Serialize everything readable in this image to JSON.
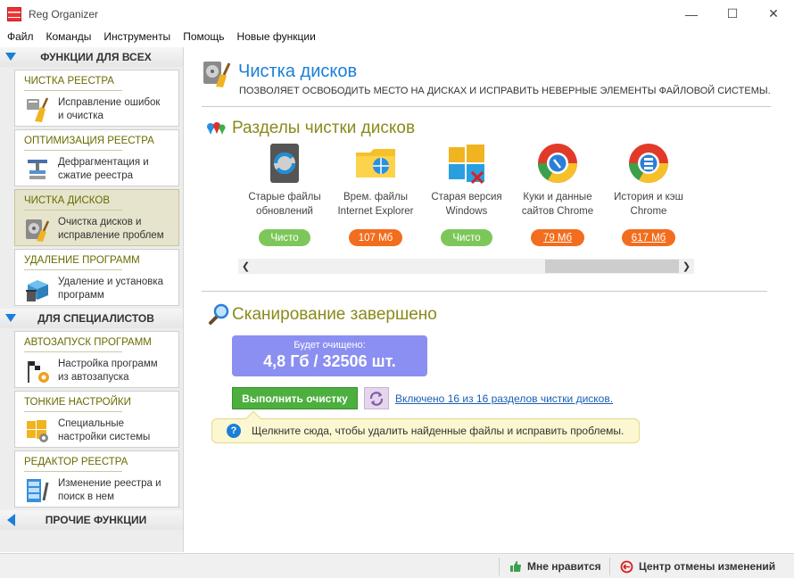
{
  "window": {
    "title": "Reg Organizer"
  },
  "menu": [
    "Файл",
    "Команды",
    "Инструменты",
    "Помощь",
    "Новые функции"
  ],
  "sidebar": {
    "section_all": "ФУНКЦИИ ДЛЯ ВСЕХ",
    "section_pro": "ДЛЯ СПЕЦИАЛИСТОВ",
    "section_other": "ПРОЧИЕ ФУНКЦИИ",
    "items": [
      {
        "title": "ЧИСТКА РЕЕСТРА",
        "desc1": "Исправление ошибок",
        "desc2": "и очистка",
        "icon": "broom-icon"
      },
      {
        "title": "ОПТИМИЗАЦИЯ РЕЕСТРА",
        "desc1": "Дефрагментация и",
        "desc2": "сжатие реестра",
        "icon": "press-icon"
      },
      {
        "title": "ЧИСТКА ДИСКОВ",
        "desc1": "Очистка дисков и",
        "desc2": "исправление проблем",
        "icon": "disk-broom-icon"
      },
      {
        "title": "УДАЛЕНИЕ ПРОГРАММ",
        "desc1": "Удаление и установка",
        "desc2": "программ",
        "icon": "box-trash-icon"
      },
      {
        "title": "АВТОЗАПУСК ПРОГРАММ",
        "desc1": "Настройка программ",
        "desc2": "из автозапуска",
        "icon": "flag-gear-icon"
      },
      {
        "title": "ТОНКИЕ НАСТРОЙКИ",
        "desc1": "Специальные",
        "desc2": "настройки системы",
        "icon": "windows-gear-icon"
      },
      {
        "title": "РЕДАКТОР РЕЕСТРА",
        "desc1": "Изменение реестра и",
        "desc2": "поиск в нем",
        "icon": "registry-edit-icon"
      }
    ]
  },
  "main": {
    "title": "Чистка дисков",
    "subtitle": "ПОЗВОЛЯЕТ ОСВОБОДИТЬ МЕСТО НА ДИСКАХ И ИСПРАВИТЬ НЕВЕРНЫЕ ЭЛЕМЕНТЫ ФАЙЛОВОЙ СИСТЕМЫ.",
    "sections_title": "Разделы чистки дисков",
    "tiles": [
      {
        "line1": "Старые файлы",
        "line2": "обновлений",
        "badge": "Чисто",
        "icon": "windows-update-icon"
      },
      {
        "line1": "Врем. файлы",
        "line2": "Internet Explorer",
        "badge": "107 Мб",
        "icon": "ie-folder-icon"
      },
      {
        "line1": "Старая версия",
        "line2": "Windows",
        "badge": "Чисто",
        "icon": "windows-old-icon"
      },
      {
        "line1": "Куки и данные",
        "line2": "сайтов Chrome",
        "badge": "79 Мб",
        "icon": "chrome-cookie-icon"
      },
      {
        "line1": "История и кэш",
        "line2": "Chrome",
        "badge": "617 Мб",
        "icon": "chrome-history-icon"
      }
    ],
    "scan_title": "Сканирование завершено",
    "summary_label": "Будет очищено:",
    "summary_value": "4,8 Гб / 32506 шт.",
    "run_button": "Выполнить очистку",
    "included_link": "Включено 16 из 16 разделов чистки дисков.",
    "hint": "Щелкните сюда, чтобы удалить найденные файлы и исправить проблемы."
  },
  "status": {
    "like": "Мне нравится",
    "undo_center": "Центр отмены изменений"
  },
  "colors": {
    "accent": "#1a7fd8",
    "section_title": "#8a8a1a",
    "clean": "#7dc75a",
    "size": "#f26d1d",
    "summary": "#8b8ff2",
    "run": "#4caf3e"
  }
}
